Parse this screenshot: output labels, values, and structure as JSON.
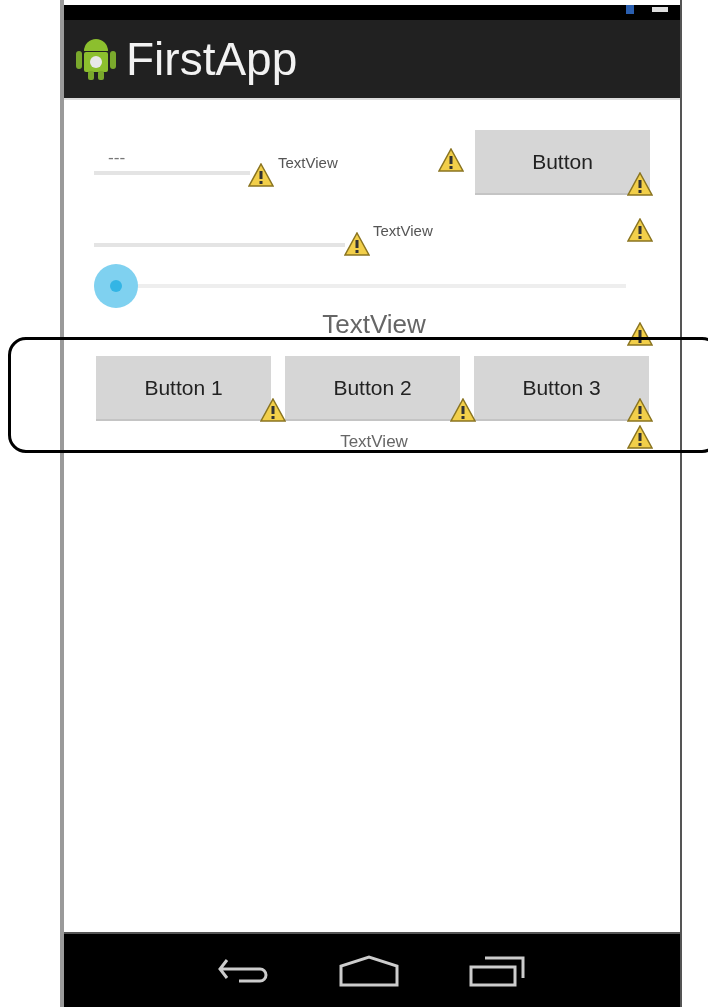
{
  "app_bar": {
    "title": "FirstApp"
  },
  "row_1": {
    "field": {
      "value": "---"
    },
    "label": "TextView",
    "button": "Button"
  },
  "row_2": {
    "label": "TextView"
  },
  "title_label": "TextView",
  "buttons": [
    {
      "label": "Button 1"
    },
    {
      "label": "Button 2"
    },
    {
      "label": "Button 3"
    }
  ],
  "footer_label": "TextView"
}
